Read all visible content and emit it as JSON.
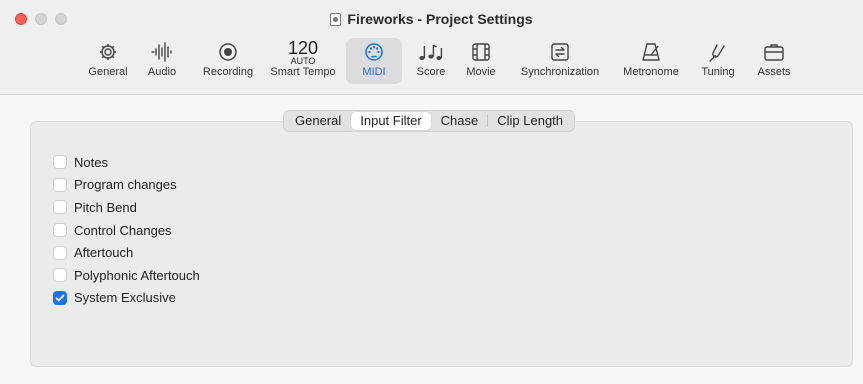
{
  "window": {
    "title": "Fireworks - Project Settings"
  },
  "toolbar": {
    "items": [
      {
        "label": "General",
        "icon": "gear-icon"
      },
      {
        "label": "Audio",
        "icon": "waveform-icon"
      },
      {
        "label": "Recording",
        "icon": "record-icon"
      },
      {
        "label": "Smart Tempo",
        "icon": "tempo-icon",
        "tempo_value": "120",
        "tempo_mode": "AUTO"
      },
      {
        "label": "MIDI",
        "icon": "midi-connector-icon",
        "active": true
      },
      {
        "label": "Score",
        "icon": "music-notes-icon"
      },
      {
        "label": "Movie",
        "icon": "film-icon"
      },
      {
        "label": "Synchronization",
        "icon": "sync-icon"
      },
      {
        "label": "Metronome",
        "icon": "metronome-icon"
      },
      {
        "label": "Tuning",
        "icon": "tuning-fork-icon"
      },
      {
        "label": "Assets",
        "icon": "briefcase-icon"
      }
    ]
  },
  "tabs": [
    {
      "label": "General",
      "selected": false
    },
    {
      "label": "Input Filter",
      "selected": true
    },
    {
      "label": "Chase",
      "selected": false
    },
    {
      "label": "Clip Length",
      "selected": false
    }
  ],
  "input_filter": {
    "options": [
      {
        "label": "Notes",
        "checked": false
      },
      {
        "label": "Program changes",
        "checked": false
      },
      {
        "label": "Pitch Bend",
        "checked": false
      },
      {
        "label": "Control Changes",
        "checked": false
      },
      {
        "label": "Aftertouch",
        "checked": false
      },
      {
        "label": "Polyphonic Aftertouch",
        "checked": false
      },
      {
        "label": "System Exclusive",
        "checked": true
      }
    ]
  },
  "colors": {
    "accent": "#1a73e8",
    "close": "#ff5f57"
  }
}
